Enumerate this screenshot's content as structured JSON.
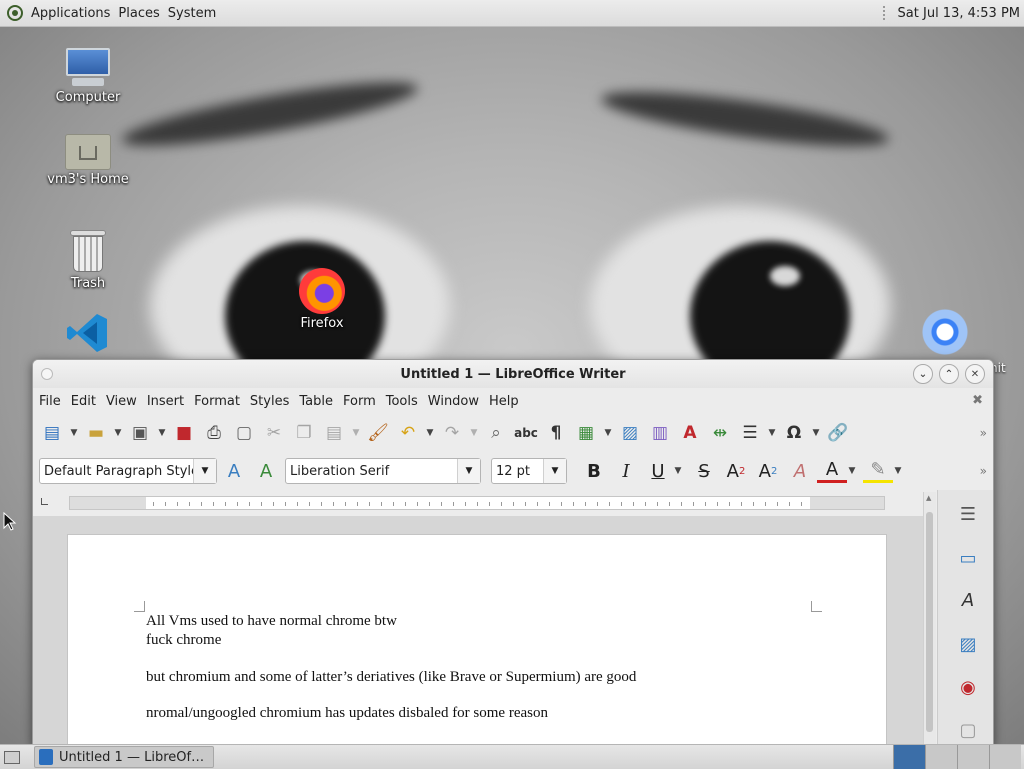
{
  "top_panel": {
    "menus": [
      "Applications",
      "Places",
      "System"
    ],
    "clock": "Sat Jul 13,  4:53 PM"
  },
  "desktop": {
    "icons": [
      {
        "label": "Computer",
        "icon": "computer-icon"
      },
      {
        "label": "vm3's Home",
        "icon": "home-folder-icon"
      },
      {
        "label": "Trash",
        "icon": "trash-icon"
      },
      {
        "label": "Firefox",
        "icon": "firefox-icon"
      },
      {
        "label": "",
        "icon": "vscode-icon"
      },
      {
        "label": "",
        "icon": "chromium-icon"
      }
    ],
    "partial_label": "hit"
  },
  "window": {
    "title": "Untitled 1 — LibreOffice Writer",
    "menu": [
      "File",
      "Edit",
      "View",
      "Insert",
      "Format",
      "Styles",
      "Table",
      "Form",
      "Tools",
      "Window",
      "Help"
    ],
    "paragraph_style": "Default Paragraph Style",
    "font_name": "Liberation Serif",
    "font_size": "12 pt",
    "document": {
      "lines": [
        "All Vms used to have normal chrome btw",
        "fuck chrome",
        "but chromium and some of latter’s deriatives (like Brave or Supermium) are good",
        "nromal/ungoogled chromium has updates disbaled for some reason"
      ]
    }
  },
  "taskbar": {
    "tasks": [
      {
        "label": "Untitled 1 — LibreOf…",
        "active": true
      }
    ]
  },
  "colors": {
    "accent": "#2a6ebd",
    "workspace_active": "#3b6ea8"
  }
}
